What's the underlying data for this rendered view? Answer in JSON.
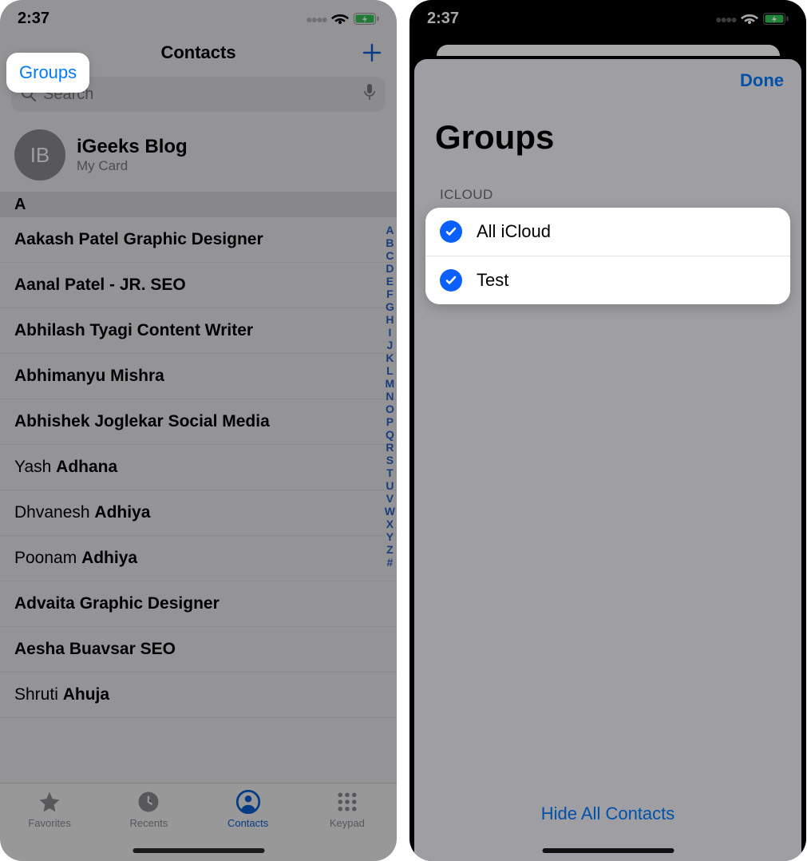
{
  "status": {
    "time": "2:37"
  },
  "left": {
    "nav": {
      "groups": "Groups",
      "title": "Contacts"
    },
    "search": {
      "placeholder": "Search"
    },
    "mycard": {
      "initials": "IB",
      "name": "iGeeks Blog",
      "sub": "My Card"
    },
    "section": "A",
    "contacts": [
      "Aakash Patel Graphic Designer",
      "Aanal Patel - JR. SEO",
      "Abhilash Tyagi Content Writer",
      "Abhimanyu Mishra",
      "Abhishek Joglekar Social Media",
      "Yash Adhana",
      "Dhvanesh Adhiya",
      "Poonam Adhiya",
      "Advaita Graphic Designer",
      "Aesha Buavsar SEO",
      "Shruti Ahuja"
    ],
    "contacts_bold_from": [
      0,
      0,
      0,
      0,
      0,
      5,
      9,
      7,
      0,
      0,
      7
    ],
    "index": [
      "A",
      "B",
      "C",
      "D",
      "E",
      "F",
      "G",
      "H",
      "I",
      "J",
      "K",
      "L",
      "M",
      "N",
      "O",
      "P",
      "Q",
      "R",
      "S",
      "T",
      "U",
      "V",
      "W",
      "X",
      "Y",
      "Z",
      "#"
    ],
    "tabs": {
      "favorites": "Favorites",
      "recents": "Recents",
      "contacts": "Contacts",
      "keypad": "Keypad"
    }
  },
  "right": {
    "done": "Done",
    "title": "Groups",
    "section": "ICLOUD",
    "groups": [
      "All iCloud",
      "Test"
    ],
    "hide_all": "Hide All Contacts"
  }
}
